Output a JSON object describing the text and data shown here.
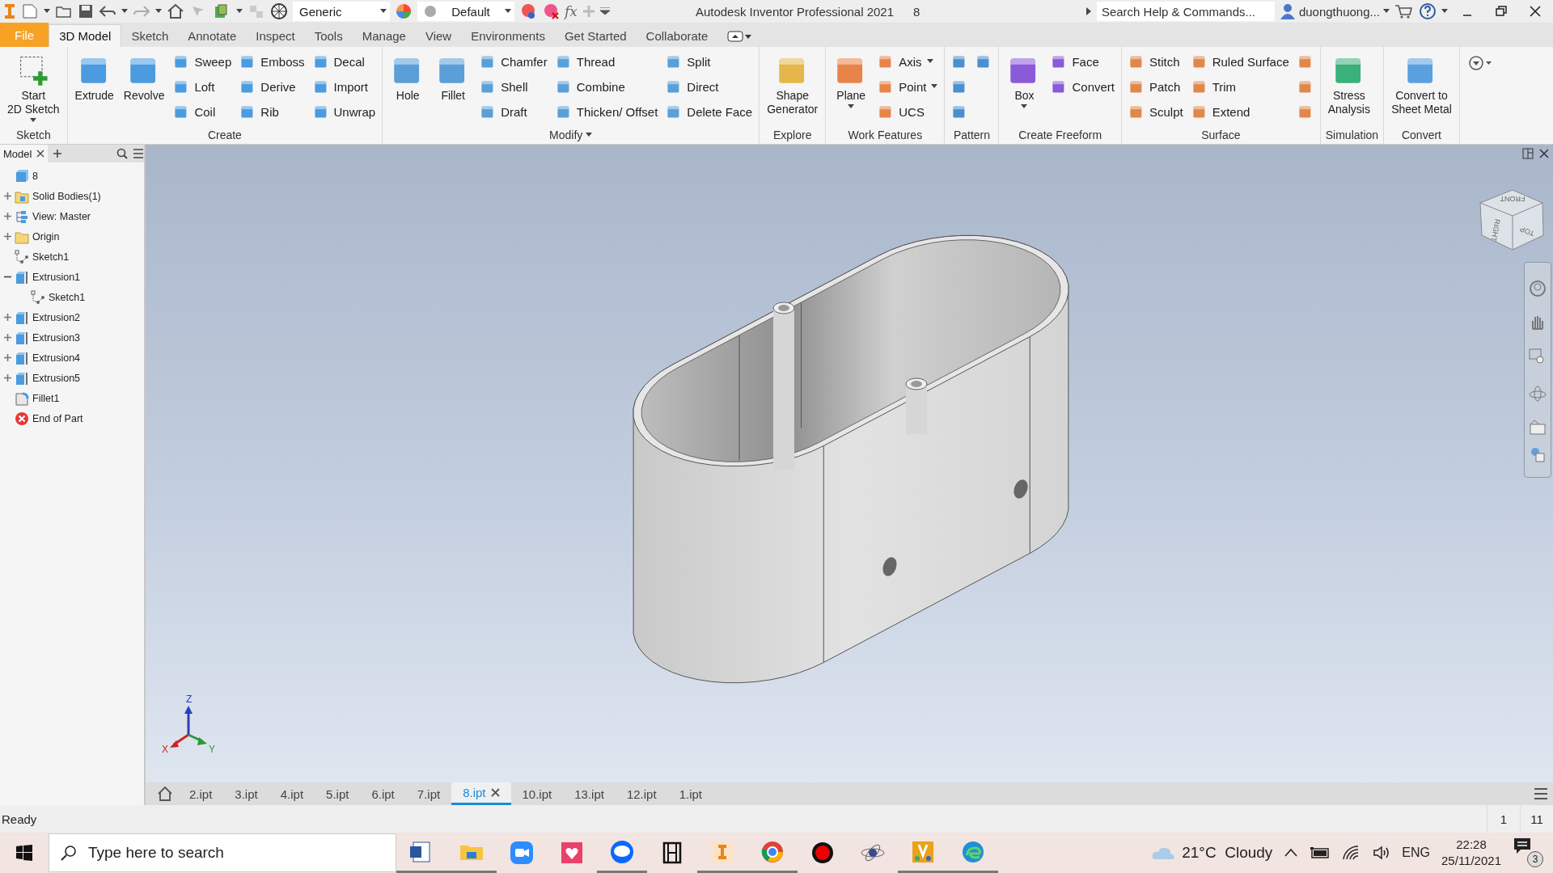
{
  "title_bar": {
    "style_dropdown": "Generic",
    "appearance_dropdown": "Default",
    "formula_label": "fx",
    "app_title": "Autodesk Inventor Professional 2021",
    "document": "8",
    "search_placeholder": "Search Help & Commands...",
    "user": "duongthuong..."
  },
  "menu_tabs": [
    {
      "label": "File",
      "kind": "file",
      "selected": false
    },
    {
      "label": "3D Model",
      "kind": "tab",
      "selected": true
    },
    {
      "label": "Sketch",
      "kind": "tab",
      "selected": false
    },
    {
      "label": "Annotate",
      "kind": "tab",
      "selected": false
    },
    {
      "label": "Inspect",
      "kind": "tab",
      "selected": false
    },
    {
      "label": "Tools",
      "kind": "tab",
      "selected": false
    },
    {
      "label": "Manage",
      "kind": "tab",
      "selected": false
    },
    {
      "label": "View",
      "kind": "tab",
      "selected": false
    },
    {
      "label": "Environments",
      "kind": "tab",
      "selected": false
    },
    {
      "label": "Get Started",
      "kind": "tab",
      "selected": false
    },
    {
      "label": "Collaborate",
      "kind": "tab",
      "selected": false
    }
  ],
  "ribbon_panels": [
    {
      "title": "Sketch",
      "menu": false,
      "columns": [
        {
          "kind": "large",
          "label": "Start\n2D Sketch",
          "dropdown": true
        }
      ]
    },
    {
      "title": "Create",
      "menu": false,
      "columns": [
        {
          "kind": "large",
          "label": "Extrude",
          "dropdown": false
        },
        {
          "kind": "large",
          "label": "Revolve",
          "dropdown": false
        },
        {
          "kind": "stack",
          "items": [
            {
              "label": "Sweep",
              "dropdown": false
            },
            {
              "label": "Loft",
              "dropdown": false
            },
            {
              "label": "Coil",
              "dropdown": false
            }
          ]
        },
        {
          "kind": "stack",
          "items": [
            {
              "label": "Emboss",
              "dropdown": false
            },
            {
              "label": "Derive",
              "dropdown": false
            },
            {
              "label": "Rib",
              "dropdown": false
            }
          ]
        },
        {
          "kind": "stack",
          "items": [
            {
              "label": "Decal",
              "dropdown": false
            },
            {
              "label": "Import",
              "dropdown": false
            },
            {
              "label": "Unwrap",
              "dropdown": false
            }
          ]
        }
      ]
    },
    {
      "title": "Modify",
      "menu": true,
      "columns": [
        {
          "kind": "large",
          "label": "Hole",
          "dropdown": false
        },
        {
          "kind": "large",
          "label": "Fillet",
          "dropdown": false
        },
        {
          "kind": "stack",
          "items": [
            {
              "label": "Chamfer",
              "dropdown": false
            },
            {
              "label": "Shell",
              "dropdown": false
            },
            {
              "label": "Draft",
              "dropdown": false
            }
          ]
        },
        {
          "kind": "stack",
          "items": [
            {
              "label": "Thread",
              "dropdown": false
            },
            {
              "label": "Combine",
              "dropdown": false
            },
            {
              "label": "Thicken/ Offset",
              "dropdown": false
            }
          ]
        },
        {
          "kind": "stack",
          "items": [
            {
              "label": "Split",
              "dropdown": false
            },
            {
              "label": "Direct",
              "dropdown": false
            },
            {
              "label": "Delete Face",
              "dropdown": false
            }
          ]
        }
      ]
    },
    {
      "title": "Explore",
      "menu": false,
      "columns": [
        {
          "kind": "large",
          "label": "Shape\nGenerator",
          "dropdown": false
        }
      ]
    },
    {
      "title": "Work Features",
      "menu": false,
      "columns": [
        {
          "kind": "large",
          "label": "Plane",
          "dropdown": true
        },
        {
          "kind": "stack",
          "items": [
            {
              "label": "Axis",
              "dropdown": true
            },
            {
              "label": "Point",
              "dropdown": true
            },
            {
              "label": "UCS",
              "dropdown": false
            }
          ]
        }
      ]
    },
    {
      "title": "Pattern",
      "menu": false,
      "columns": [
        {
          "kind": "icon_stack"
        },
        {
          "kind": "icon_single"
        }
      ]
    },
    {
      "title": "Create Freeform",
      "menu": false,
      "columns": [
        {
          "kind": "large",
          "label": "Box",
          "dropdown": true
        },
        {
          "kind": "stack",
          "items": [
            {
              "label": "Face",
              "dropdown": false
            },
            {
              "label": "Convert",
              "dropdown": false
            }
          ]
        }
      ]
    },
    {
      "title": "Surface",
      "menu": false,
      "columns": [
        {
          "kind": "stack",
          "items": [
            {
              "label": "Stitch",
              "dropdown": false
            },
            {
              "label": "Patch",
              "dropdown": false
            },
            {
              "label": "Sculpt",
              "dropdown": false
            }
          ]
        },
        {
          "kind": "stack",
          "items": [
            {
              "label": "Ruled Surface",
              "dropdown": false
            },
            {
              "label": "Trim",
              "dropdown": false
            },
            {
              "label": "Extend",
              "dropdown": false
            }
          ]
        },
        {
          "kind": "icon_stack"
        }
      ]
    },
    {
      "title": "Simulation",
      "menu": false,
      "columns": [
        {
          "kind": "large",
          "label": "Stress\nAnalysis",
          "dropdown": false
        }
      ]
    },
    {
      "title": "Convert",
      "menu": false,
      "columns": [
        {
          "kind": "large",
          "label": "Convert to\nSheet Metal",
          "dropdown": false
        }
      ]
    }
  ],
  "browser": {
    "tab": "Model",
    "tree": [
      {
        "label": "8",
        "kind": "part",
        "children": [
          {
            "label": "Solid Bodies(1)",
            "kind": "bodies",
            "expanded": false
          },
          {
            "label": "View: Master",
            "kind": "view",
            "expanded": false
          },
          {
            "label": "Origin",
            "kind": "folder",
            "expanded": false
          },
          {
            "label": "Sketch1",
            "kind": "sketch"
          },
          {
            "label": "Extrusion1",
            "kind": "extrusion",
            "expanded": true,
            "children": [
              {
                "label": "Sketch1",
                "kind": "sketch"
              }
            ]
          },
          {
            "label": "Extrusion2",
            "kind": "extrusion",
            "expanded": false
          },
          {
            "label": "Extrusion3",
            "kind": "extrusion",
            "expanded": false
          },
          {
            "label": "Extrusion4",
            "kind": "extrusion",
            "expanded": false
          },
          {
            "label": "Extrusion5",
            "kind": "extrusion",
            "expanded": false
          },
          {
            "label": "Fillet1",
            "kind": "fillet"
          },
          {
            "label": "End of Part",
            "kind": "end"
          }
        ]
      }
    ]
  },
  "viewport": {
    "view_cube": [
      "FRONT",
      "RIGHT",
      "TOP"
    ],
    "axes": [
      "Z",
      "X",
      "Y"
    ]
  },
  "document_tabs": [
    {
      "label": "2.ipt",
      "selected": false
    },
    {
      "label": "3.ipt",
      "selected": false
    },
    {
      "label": "4.ipt",
      "selected": false
    },
    {
      "label": "5.ipt",
      "selected": false
    },
    {
      "label": "6.ipt",
      "selected": false
    },
    {
      "label": "7.ipt",
      "selected": false
    },
    {
      "label": "8.ipt",
      "selected": true
    },
    {
      "label": "10.ipt",
      "selected": false
    },
    {
      "label": "13.ipt",
      "selected": false
    },
    {
      "label": "12.ipt",
      "selected": false
    },
    {
      "label": "1.ipt",
      "selected": false
    }
  ],
  "status_bar": {
    "message": "Ready",
    "cells": [
      "1",
      "11"
    ]
  },
  "taskbar": {
    "search_placeholder": "Type here to search",
    "apps": [
      {
        "kind": "word",
        "active": true
      },
      {
        "kind": "folder",
        "active": true
      },
      {
        "kind": "video",
        "active": false
      },
      {
        "kind": "dating",
        "active": false
      },
      {
        "kind": "chat",
        "active": true
      },
      {
        "kind": "film",
        "active": false
      },
      {
        "kind": "inventor",
        "active": true
      },
      {
        "kind": "browser",
        "active": true
      },
      {
        "kind": "record",
        "active": false
      },
      {
        "kind": "atom",
        "active": false
      },
      {
        "kind": "math",
        "active": true
      },
      {
        "kind": "edge",
        "active": true
      }
    ],
    "weather": "21°C  Cloudy",
    "language": "ENG",
    "time": "22:28",
    "date": "25/11/2021",
    "notifications": "3"
  }
}
